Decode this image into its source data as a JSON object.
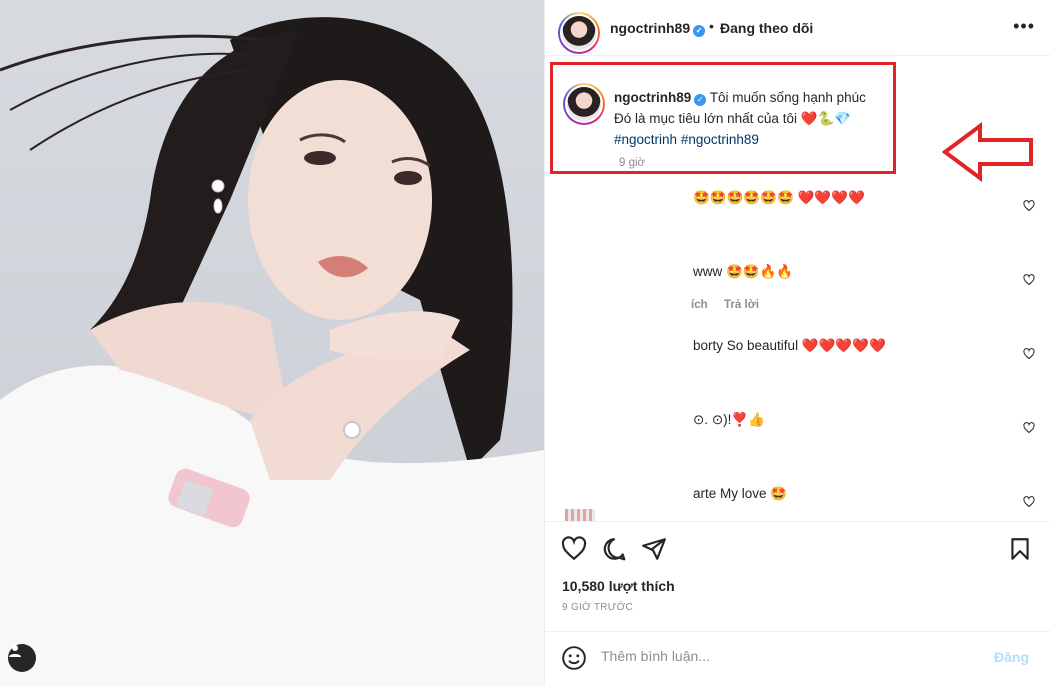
{
  "post": {
    "username": "ngoctrinh89",
    "verified_mark": "✓",
    "dot": "•",
    "follow_status": "Đang theo dõi",
    "more_label": "•••"
  },
  "caption": {
    "username": "ngoctrinh89",
    "line1": "Tôi muốn sống hạnh phúc",
    "line2": "Đó là mục tiêu lớn nhất của tôi ❤️🐍💎",
    "hashtag1": "#ngoctrinh",
    "hashtag2": "#ngoctrinh89",
    "time": "9 giờ"
  },
  "comments": [
    {
      "text": "🤩🤩🤩🤩🤩🤩 ❤️❤️❤️❤️"
    },
    {
      "text": "www 🤩🤩🔥🔥"
    },
    {
      "meta_left": "ích",
      "reply": "Trả lời"
    },
    {
      "text": "borty So beautiful ❤️❤️❤️❤️❤️"
    },
    {
      "text": "⊙. ⊙)!❣️👍"
    },
    {
      "text": "arte My love 🤩"
    }
  ],
  "actions": {
    "likes": "10,580 lượt thích",
    "ago": "9 GIỜ TRƯỚC"
  },
  "compose": {
    "placeholder": "Thêm bình luận...",
    "post_label": "Đăng"
  },
  "colors": {
    "highlight_border": "#e0242a",
    "hashtag": "#00376b",
    "verified": "#3897f0",
    "post_button_disabled": "#b2dffc"
  }
}
